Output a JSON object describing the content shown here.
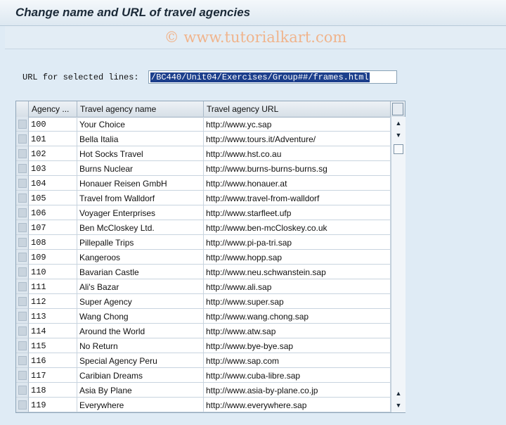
{
  "title": "Change name and URL of travel agencies",
  "watermark": "© www.tutorialkart.com",
  "url_form": {
    "label": "URL for selected lines:",
    "value": "/BC440/Unit04/Exercises/Group##/frames.html"
  },
  "table": {
    "columns": [
      "Agency ...",
      "Travel agency name",
      "Travel agency URL"
    ],
    "rows": [
      [
        "100",
        "Your Choice",
        "http://www.yc.sap"
      ],
      [
        "101",
        "Bella Italia",
        "http://www.tours.it/Adventure/"
      ],
      [
        "102",
        "Hot Socks Travel",
        "http://www.hst.co.au"
      ],
      [
        "103",
        "Burns Nuclear",
        "http://www.burns-burns-burns.sg"
      ],
      [
        "104",
        "Honauer Reisen GmbH",
        "http://www.honauer.at"
      ],
      [
        "105",
        "Travel from Walldorf",
        "http://www.travel-from-walldorf"
      ],
      [
        "106",
        "Voyager Enterprises",
        "http://www.starfleet.ufp"
      ],
      [
        "107",
        "Ben McCloskey Ltd.",
        "http://www.ben-mcCloskey.co.uk"
      ],
      [
        "108",
        "Pillepalle Trips",
        "http://www.pi-pa-tri.sap"
      ],
      [
        "109",
        "Kangeroos",
        "http://www.hopp.sap"
      ],
      [
        "110",
        "Bavarian Castle",
        "http://www.neu.schwanstein.sap"
      ],
      [
        "111",
        "Ali's Bazar",
        "http://www.ali.sap"
      ],
      [
        "112",
        "Super Agency",
        "http://www.super.sap"
      ],
      [
        "113",
        "Wang Chong",
        "http://www.wang.chong.sap"
      ],
      [
        "114",
        "Around the World",
        "http://www.atw.sap"
      ],
      [
        "115",
        "No Return",
        "http://www.bye-bye.sap"
      ],
      [
        "116",
        "Special Agency Peru",
        "http://www.sap.com"
      ],
      [
        "117",
        "Caribian Dreams",
        "http://www.cuba-libre.sap"
      ],
      [
        "118",
        "Asia By Plane",
        "http://www.asia-by-plane.co.jp"
      ],
      [
        "119",
        "Everywhere",
        "http://www.everywhere.sap"
      ]
    ]
  },
  "scrollbar": {
    "up_icon": "▲",
    "down_icon": "▼"
  }
}
